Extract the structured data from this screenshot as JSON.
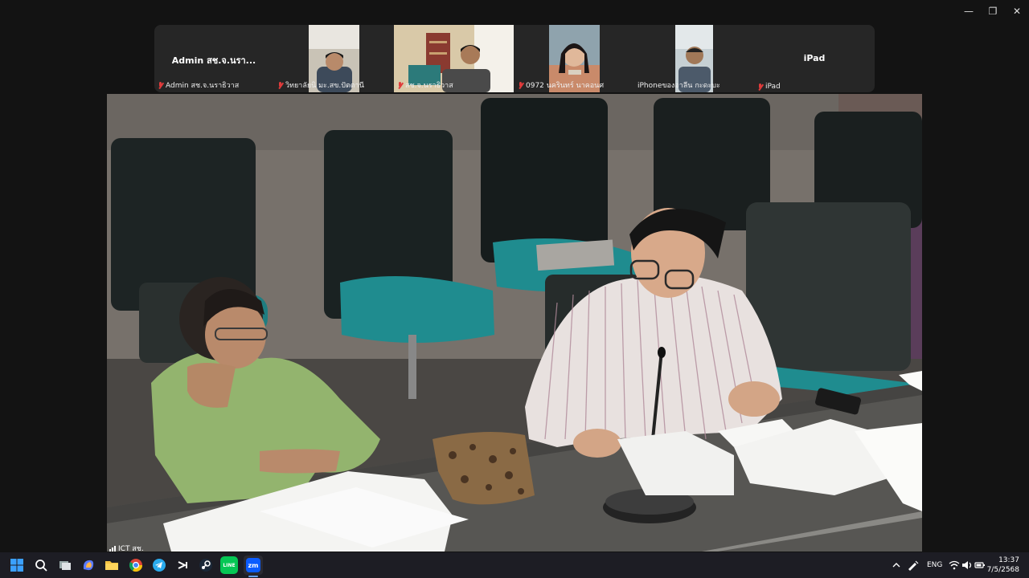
{
  "window": {
    "minimize": "—",
    "restore": "❐",
    "close": "✕"
  },
  "participants": [
    {
      "display_name": "Admin สช.จ.นรา...",
      "label": "Admin สช.จ.นราธิวาส",
      "has_video": false
    },
    {
      "display_name": "",
      "label": "วิทยาลัยนิ มะ.สข.ปัตตานี",
      "has_video": true
    },
    {
      "display_name": "",
      "label": "สช.จ.นราธิวาส",
      "has_video": true
    },
    {
      "display_name": "",
      "label": "0972 นครินทร์ นาคอนศ",
      "has_video": true
    },
    {
      "display_name": "",
      "label": "iPhoneของอาลีน กะดะบะ",
      "has_video": true
    },
    {
      "display_name": "iPad",
      "label": "iPad",
      "has_video": false
    }
  ],
  "main_video": {
    "label": "ICT สช."
  },
  "taskbar": {
    "apps": [
      "start-icon",
      "search-icon",
      "task-view-icon",
      "copilot-icon",
      "file-explorer-icon",
      "chrome-icon",
      "telegram-icon",
      "capcut-icon",
      "steam-icon",
      "line-icon",
      "zoom-icon"
    ],
    "zoom_label": "zm",
    "line_label": "LINE",
    "lang": "ENG",
    "time": "13:37",
    "date": "7/5/2568"
  },
  "colors": {
    "accent": "#0b5cff",
    "mute": "#e03b3b",
    "taskbar": "#1d1d24"
  }
}
